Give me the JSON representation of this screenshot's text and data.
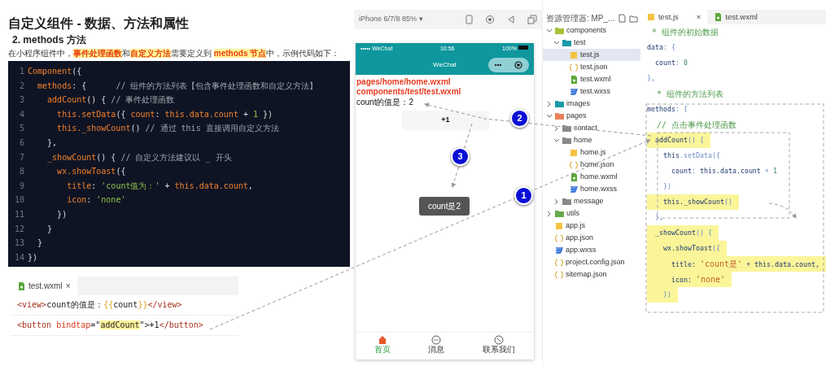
{
  "slide": {
    "title": "自定义组件 - 数据、方法和属性",
    "subtitle": "2. methods 方法",
    "intro": [
      {
        "text": "在小程序组件中，",
        "highlighted": false
      },
      {
        "text": "事件处理函数",
        "highlighted": true
      },
      {
        "text": "和",
        "highlighted": false
      },
      {
        "text": "自定义方法",
        "highlighted": true
      },
      {
        "text": "需要定义到 ",
        "highlighted": false
      },
      {
        "text": "methods 节点",
        "highlighted": true
      },
      {
        "text": "中，示例代码如下：",
        "highlighted": false
      }
    ],
    "code": [
      {
        "num": "1",
        "tokens": [
          {
            "text": "Component",
            "kind": "kw"
          },
          {
            "text": "({",
            "kind": "pl"
          }
        ]
      },
      {
        "num": "2",
        "tokens": [
          {
            "text": "  methods",
            "kind": "kw"
          },
          {
            "text": ": {      ",
            "kind": "pl"
          },
          {
            "text": "// 组件的方法列表【包含事件处理函数和自定义方法】",
            "kind": "com"
          }
        ]
      },
      {
        "num": "3",
        "tokens": [
          {
            "text": "    addCount",
            "kind": "kw"
          },
          {
            "text": "() { ",
            "kind": "pl"
          },
          {
            "text": "// 事件处理函数",
            "kind": "com"
          }
        ]
      },
      {
        "num": "4",
        "tokens": [
          {
            "text": "      this.setData",
            "kind": "kw"
          },
          {
            "text": "({ ",
            "kind": "pl"
          },
          {
            "text": "count",
            "kind": "kw"
          },
          {
            "text": ": ",
            "kind": "pl"
          },
          {
            "text": "this.data.count",
            "kind": "kw"
          },
          {
            "text": " + ",
            "kind": "pl"
          },
          {
            "text": "1",
            "kind": "str"
          },
          {
            "text": " })",
            "kind": "pl"
          }
        ]
      },
      {
        "num": "5",
        "tokens": [
          {
            "text": "      this._showCount",
            "kind": "kw"
          },
          {
            "text": "() ",
            "kind": "pl"
          },
          {
            "text": "// 通过 this 直接调用自定义方法",
            "kind": "com"
          }
        ]
      },
      {
        "num": "6",
        "tokens": [
          {
            "text": "    },",
            "kind": "pl"
          }
        ]
      },
      {
        "num": "7",
        "tokens": [
          {
            "text": "    _showCount",
            "kind": "kw"
          },
          {
            "text": "() { ",
            "kind": "pl"
          },
          {
            "text": "// 自定义方法建议以 _ 开头",
            "kind": "com"
          }
        ]
      },
      {
        "num": "8",
        "tokens": [
          {
            "text": "      wx.showToast",
            "kind": "kw"
          },
          {
            "text": "({",
            "kind": "pl"
          }
        ]
      },
      {
        "num": "9",
        "tokens": [
          {
            "text": "        title",
            "kind": "kw"
          },
          {
            "text": ": ",
            "kind": "pl"
          },
          {
            "text": "'count值为：'",
            "kind": "str"
          },
          {
            "text": " + ",
            "kind": "pl"
          },
          {
            "text": "this.data.count",
            "kind": "kw"
          },
          {
            "text": ",",
            "kind": "pl"
          }
        ]
      },
      {
        "num": "10",
        "tokens": [
          {
            "text": "        icon",
            "kind": "kw"
          },
          {
            "text": ": ",
            "kind": "pl"
          },
          {
            "text": "'none'",
            "kind": "str"
          }
        ]
      },
      {
        "num": "11",
        "tokens": [
          {
            "text": "      })",
            "kind": "pl"
          }
        ]
      },
      {
        "num": "12",
        "tokens": [
          {
            "text": "    }",
            "kind": "pl"
          }
        ]
      },
      {
        "num": "13",
        "tokens": [
          {
            "text": "  }",
            "kind": "pl"
          }
        ]
      },
      {
        "num": "14",
        "tokens": [
          {
            "text": "})",
            "kind": "pl"
          }
        ]
      }
    ]
  },
  "wxml_editor": {
    "tab": "test.wxml",
    "close": "×",
    "lines": [
      {
        "tokens": [
          {
            "text": "<view>",
            "kind": "tag",
            "highlighted": false
          },
          {
            "text": "count的值是：",
            "kind": "pl",
            "highlighted": false
          },
          {
            "text": "{{",
            "kind": "brace",
            "highlighted": false
          },
          {
            "text": "count",
            "kind": "pl",
            "highlighted": false
          },
          {
            "text": "}}",
            "kind": "brace",
            "highlighted": false
          },
          {
            "text": "</view>",
            "kind": "tag",
            "highlighted": false
          }
        ]
      },
      {
        "tokens": [
          {
            "text": "<button ",
            "kind": "tag",
            "highlighted": false
          },
          {
            "text": "bindtap",
            "kind": "attr",
            "highlighted": false
          },
          {
            "text": "=\"",
            "kind": "pl",
            "highlighted": false
          },
          {
            "text": "addCount",
            "kind": "pl",
            "highlighted": true
          },
          {
            "text": "\">+1",
            "kind": "pl",
            "highlighted": false
          },
          {
            "text": "</button>",
            "kind": "tag",
            "highlighted": false
          }
        ]
      }
    ]
  },
  "simulator": {
    "device": "iPhone 6/7/8 85% ▾",
    "status_bar": {
      "carrier": "••••• WeChat",
      "time": "10:56",
      "battery": "100%"
    },
    "nav_title": "WeChat",
    "capsule_menu": "•••",
    "page_lines": [
      {
        "text": "pages/home/home.wxml",
        "kind": "path"
      },
      {
        "text": "components/test/test.wxml",
        "kind": "path"
      },
      {
        "text": "count的值是：2",
        "kind": "text"
      }
    ],
    "button": "+1",
    "toast": "count是2",
    "tabs": [
      {
        "label": "首页",
        "selected": true,
        "kind": "home"
      },
      {
        "label": "消息",
        "selected": false,
        "kind": "chat"
      },
      {
        "label": "联系我们",
        "selected": false,
        "kind": "phone"
      }
    ]
  },
  "explorer": {
    "title": "资源管理器: MP_...",
    "items": [
      {
        "name": "components",
        "kind": "folder",
        "color": "#a5c23a",
        "expanded": true,
        "selected": false,
        "children": [
          {
            "name": "test",
            "kind": "folder",
            "color": "#1a9aa8",
            "expanded": true,
            "selected": false,
            "children": [
              {
                "name": "test.js",
                "kind": "js",
                "selected": true
              },
              {
                "name": "test.json",
                "kind": "json",
                "selected": false
              },
              {
                "name": "test.wxml",
                "kind": "wxml",
                "selected": false
              },
              {
                "name": "test.wxss",
                "kind": "wxss",
                "selected": false
              }
            ]
          }
        ]
      },
      {
        "name": "images",
        "kind": "folder",
        "color": "#1a9aa8",
        "expanded": false,
        "selected": false
      },
      {
        "name": "pages",
        "kind": "folder",
        "color": "#e8805a",
        "expanded": true,
        "selected": false,
        "children": [
          {
            "name": "contact",
            "kind": "folder",
            "color": "#8a8a8a",
            "expanded": false,
            "selected": false
          },
          {
            "name": "home",
            "kind": "folder",
            "color": "#8a8a8a",
            "expanded": true,
            "selected": false,
            "children": [
              {
                "name": "home.js",
                "kind": "js",
                "selected": false
              },
              {
                "name": "home.json",
                "kind": "json",
                "selected": false
              },
              {
                "name": "home.wxml",
                "kind": "wxml",
                "selected": false
              },
              {
                "name": "home.wxss",
                "kind": "wxss",
                "selected": false
              }
            ]
          },
          {
            "name": "message",
            "kind": "folder",
            "color": "#8a8a8a",
            "expanded": false,
            "selected": false
          }
        ]
      },
      {
        "name": "utils",
        "kind": "folder",
        "color": "#6aa84f",
        "expanded": false,
        "selected": false
      },
      {
        "name": "app.js",
        "kind": "js",
        "selected": false
      },
      {
        "name": "app.json",
        "kind": "json",
        "selected": false
      },
      {
        "name": "app.wxss",
        "kind": "wxss",
        "selected": false
      },
      {
        "name": "project.config.json",
        "kind": "json",
        "selected": false
      },
      {
        "name": "sitemap.json",
        "kind": "json",
        "selected": false
      }
    ]
  },
  "js_editor": {
    "tabs": [
      {
        "label": "test.js",
        "kind": "js",
        "selected": true,
        "close": "×"
      },
      {
        "label": "test.wxml",
        "kind": "wxml",
        "selected": false
      }
    ],
    "lines": [
      {
        "highlighted": false,
        "tokens": [
          {
            "text": " * 组件的初始数据",
            "kind": "com"
          }
        ]
      },
      {
        "highlighted": false,
        "tokens": [
          {
            "text": "data",
            "kind": "pl"
          },
          {
            "text": ": {",
            "kind": "punct"
          }
        ]
      },
      {
        "highlighted": false,
        "tokens": [
          {
            "text": "  count",
            "kind": "pl"
          },
          {
            "text": ": ",
            "kind": "punct"
          },
          {
            "text": "0",
            "kind": "num"
          }
        ]
      },
      {
        "highlighted": false,
        "tokens": [
          {
            "text": "},",
            "kind": "punct"
          }
        ]
      },
      {
        "highlighted": false,
        "tokens": [
          {
            "text": "  * 组件的方法列表",
            "kind": "com"
          }
        ]
      },
      {
        "highlighted": false,
        "tokens": [
          {
            "text": "methods",
            "kind": "pl"
          },
          {
            "text": ": {",
            "kind": "punct"
          }
        ]
      },
      {
        "highlighted": false,
        "tokens": [
          {
            "text": "  // 点击事件处理函数",
            "kind": "com"
          }
        ]
      },
      {
        "highlighted": true,
        "tokens": [
          {
            "text": "  addCount",
            "kind": "pl"
          },
          {
            "text": "() {",
            "kind": "punct"
          }
        ]
      },
      {
        "highlighted": false,
        "tokens": [
          {
            "text": "    this",
            "kind": "pl"
          },
          {
            "text": ".setData({",
            "kind": "punct"
          }
        ]
      },
      {
        "highlighted": false,
        "tokens": [
          {
            "text": "      count",
            "kind": "pl"
          },
          {
            "text": ": ",
            "kind": "punct"
          },
          {
            "text": "this.data.count",
            "kind": "pl"
          },
          {
            "text": " + ",
            "kind": "punct"
          },
          {
            "text": "1",
            "kind": "num"
          }
        ]
      },
      {
        "highlighted": false,
        "tokens": [
          {
            "text": "    })",
            "kind": "punct"
          }
        ]
      },
      {
        "highlighted": true,
        "tokens": [
          {
            "text": "    this._showCount",
            "kind": "pl"
          },
          {
            "text": "()",
            "kind": "punct"
          }
        ]
      },
      {
        "highlighted": false,
        "tokens": [
          {
            "text": "  },",
            "kind": "punct"
          }
        ]
      },
      {
        "highlighted": true,
        "tokens": [
          {
            "text": "  _showCount",
            "kind": "pl"
          },
          {
            "text": "() {",
            "kind": "punct"
          }
        ]
      },
      {
        "highlighted": true,
        "tokens": [
          {
            "text": "    wx.showToast",
            "kind": "pl"
          },
          {
            "text": "({",
            "kind": "punct"
          }
        ]
      },
      {
        "highlighted": true,
        "tokens": [
          {
            "text": "      title: ",
            "kind": "pl"
          },
          {
            "text": "'count是'",
            "kind": "str"
          },
          {
            "text": " + this.data.count,",
            "kind": "pl"
          }
        ]
      },
      {
        "highlighted": true,
        "tokens": [
          {
            "text": "      icon: ",
            "kind": "pl"
          },
          {
            "text": "'none'",
            "kind": "str"
          }
        ]
      },
      {
        "highlighted": true,
        "tokens": [
          {
            "text": "    })",
            "kind": "punct"
          }
        ]
      }
    ]
  },
  "callouts": [
    {
      "label": "1"
    },
    {
      "label": "2"
    },
    {
      "label": "3"
    }
  ]
}
